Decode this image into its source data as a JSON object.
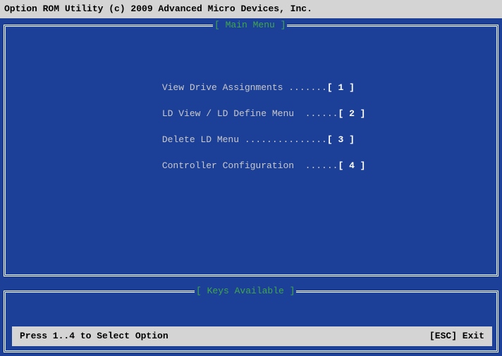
{
  "title_bar": "Option ROM Utility (c) 2009 Advanced Micro Devices, Inc.",
  "main_menu": {
    "title": "[ Main Menu ]",
    "items": [
      {
        "label": "View Drive Assignments",
        "dots": " .......",
        "key": "[ 1 ]"
      },
      {
        "label": "LD View / LD Define Menu",
        "dots": "  ......",
        "key": "[ 2 ]"
      },
      {
        "label": "Delete LD Menu",
        "dots": " ...............",
        "key": "[ 3 ]"
      },
      {
        "label": "Controller Configuration",
        "dots": "  ......",
        "key": "[ 4 ]"
      }
    ]
  },
  "keys_panel": {
    "title": "[ Keys Available ]",
    "hint": "Press 1..4 to Select Option",
    "exit": "[ESC] Exit"
  },
  "colors": {
    "background": "#1c3f98",
    "bar": "#d4d4d4",
    "title_accent": "#3fa84a",
    "menu_text": "#c9c9c9"
  }
}
